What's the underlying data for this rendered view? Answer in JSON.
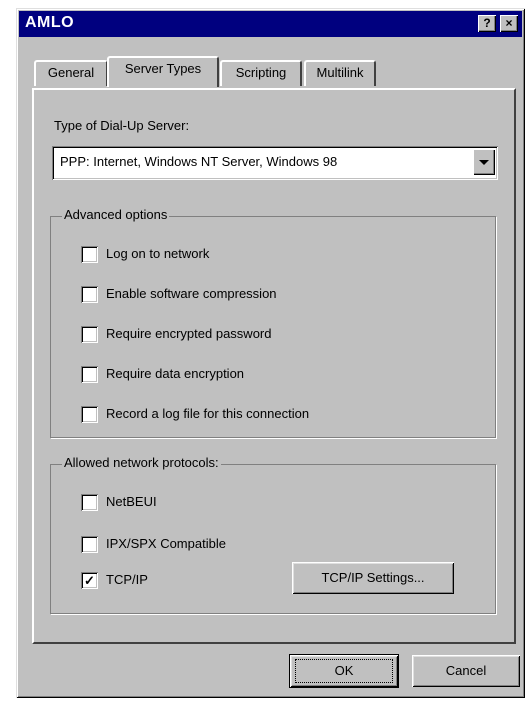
{
  "window": {
    "title": "AMLO",
    "help_glyph": "?",
    "close_glyph": "×"
  },
  "tabs": [
    {
      "label": "General",
      "active": false
    },
    {
      "label": "Server Types",
      "active": true
    },
    {
      "label": "Scripting",
      "active": false
    },
    {
      "label": "Multilink",
      "active": false
    }
  ],
  "server_type": {
    "label": "Type of Dial-Up Server:",
    "selected": "PPP: Internet, Windows NT Server, Windows 98"
  },
  "advanced": {
    "legend": "Advanced options",
    "options": [
      {
        "label": "Log on to network",
        "checked": false
      },
      {
        "label": "Enable software compression",
        "checked": false
      },
      {
        "label": "Require encrypted password",
        "checked": false
      },
      {
        "label": "Require data encryption",
        "checked": false
      },
      {
        "label": "Record a log file for this connection",
        "checked": false
      }
    ]
  },
  "protocols": {
    "legend": "Allowed network protocols:",
    "options": [
      {
        "label": "NetBEUI",
        "checked": false
      },
      {
        "label": "IPX/SPX Compatible",
        "checked": false
      },
      {
        "label": "TCP/IP",
        "checked": true
      }
    ],
    "settings_button": "TCP/IP Settings..."
  },
  "check_glyph": "✓",
  "footer": {
    "ok": "OK",
    "cancel": "Cancel"
  }
}
